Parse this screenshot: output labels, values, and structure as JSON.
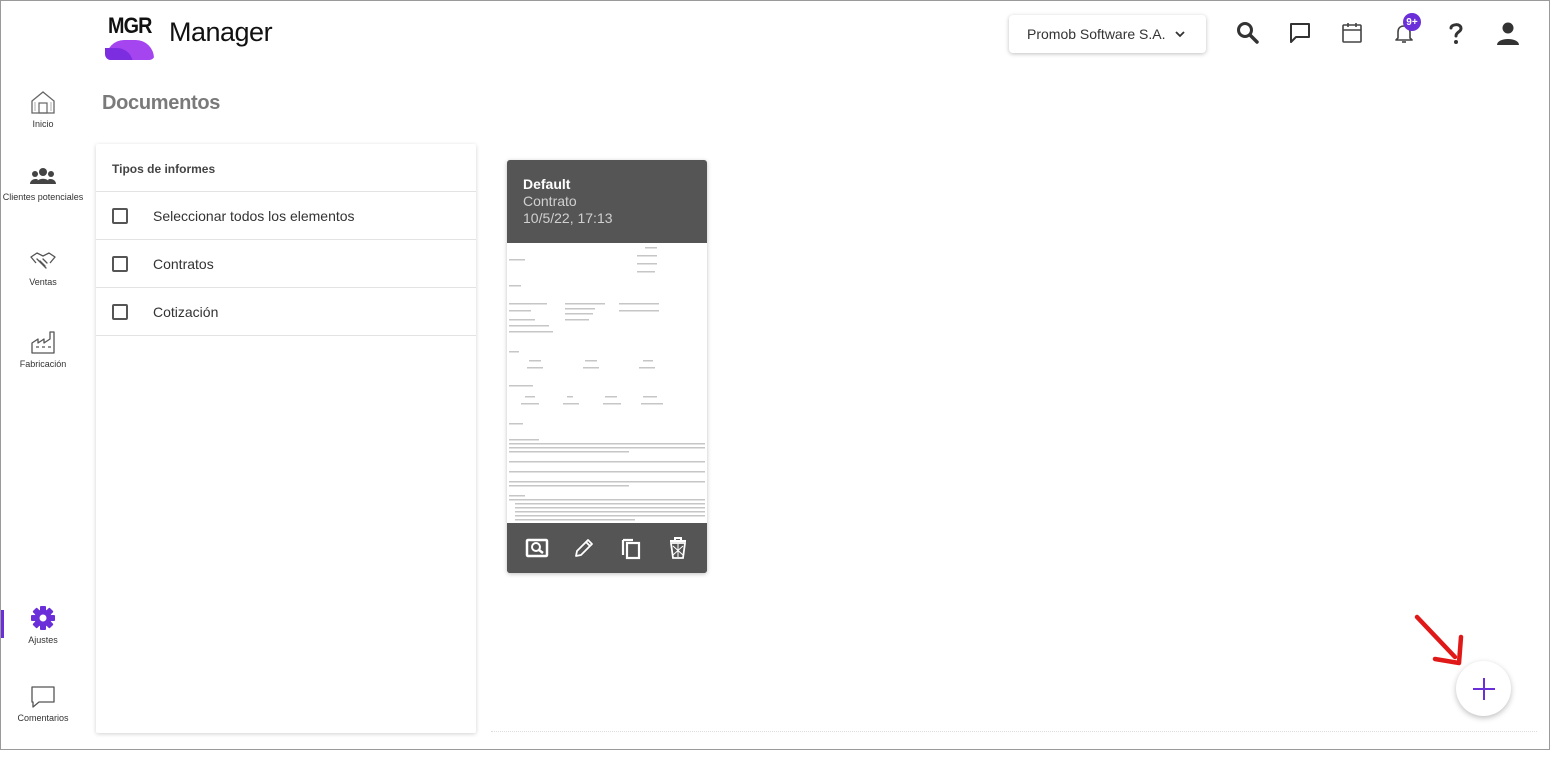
{
  "app": {
    "logo_text": "MGR",
    "title": "Manager",
    "brand_color": "#6a2fd8",
    "logo_colors": [
      "#a445f0",
      "#7d2de0"
    ]
  },
  "header": {
    "company_selector": "Promob Software S.A.",
    "icons": [
      "search-icon",
      "chat-icon",
      "calendar-icon",
      "bell-icon",
      "help-icon",
      "account-icon"
    ],
    "notification_badge": "9+"
  },
  "sidebar": {
    "items": [
      {
        "label": "Inicio",
        "icon": "home-icon",
        "active": false
      },
      {
        "label": "Clientes potenciales",
        "icon": "people-icon",
        "active": false
      },
      {
        "label": "Ventas",
        "icon": "handshake-icon",
        "active": false
      },
      {
        "label": "Fabricación",
        "icon": "factory-icon",
        "active": false
      },
      {
        "label": "Ajustes",
        "icon": "gear-icon",
        "active": true
      },
      {
        "label": "Comentarios",
        "icon": "comment-icon",
        "active": false
      }
    ]
  },
  "page": {
    "title": "Documentos"
  },
  "filter_panel": {
    "header": "Tipos de informes",
    "options": [
      {
        "label": "Seleccionar todos los elementos",
        "checked": false
      },
      {
        "label": "Contratos",
        "checked": false
      },
      {
        "label": "Cotización",
        "checked": false
      }
    ]
  },
  "documents": [
    {
      "name": "Default",
      "type": "Contrato",
      "date": "10/5/22, 17:13",
      "actions": [
        "preview-icon",
        "edit-icon",
        "copy-icon",
        "delete-icon"
      ]
    }
  ],
  "fab": {
    "icon": "plus-icon",
    "annotation": "red-arrow"
  }
}
